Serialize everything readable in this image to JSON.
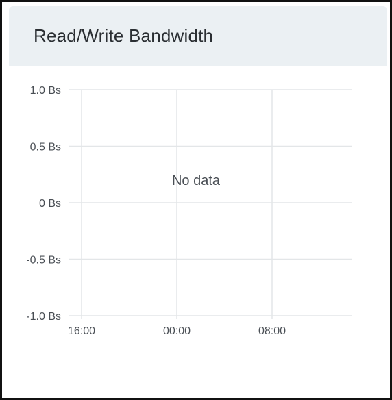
{
  "panel": {
    "title": "Read/Write Bandwidth"
  },
  "chart_data": {
    "type": "line",
    "title": "Read/Write Bandwidth",
    "xlabel": "",
    "ylabel": "",
    "x_ticks": [
      "16:00",
      "00:00",
      "08:00"
    ],
    "y_ticks": [
      "1.0 Bs",
      "0.5 Bs",
      "0 Bs",
      "-0.5 Bs",
      "-1.0 Bs"
    ],
    "y_tick_values": [
      1.0,
      0.5,
      0,
      -0.5,
      -1.0
    ],
    "ylim": [
      -1.0,
      1.0
    ],
    "series": [],
    "empty_message": "No data",
    "grid": true,
    "colors": {
      "grid": "#e3e6e8",
      "tick_text": "#4a4f55",
      "message_text": "#4a4f55"
    }
  }
}
